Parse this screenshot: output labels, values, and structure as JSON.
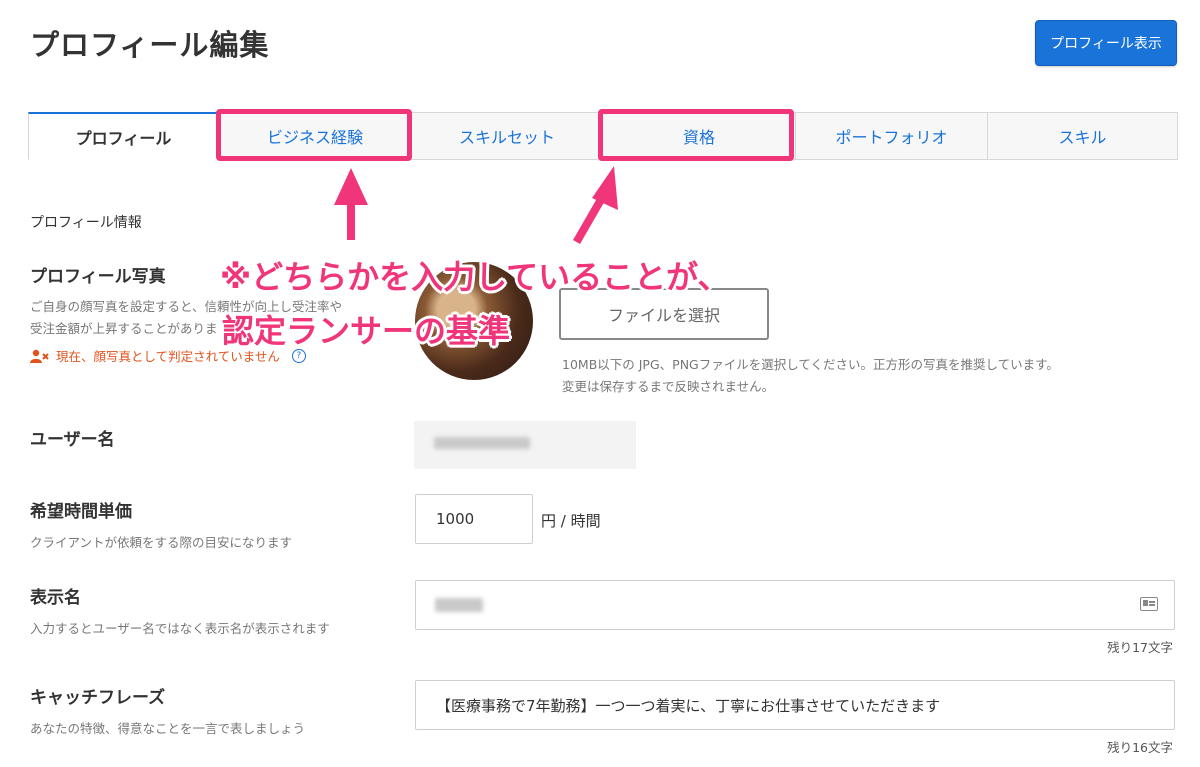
{
  "header": {
    "title": "プロフィール編集",
    "view_button": "プロフィール表示"
  },
  "tabs": [
    {
      "label": "プロフィール"
    },
    {
      "label": "ビジネス経験"
    },
    {
      "label": "スキルセット"
    },
    {
      "label": "資格"
    },
    {
      "label": "ポートフォリオ"
    },
    {
      "label": "スキル"
    }
  ],
  "section_label": "プロフィール情報",
  "photo": {
    "title": "プロフィール写真",
    "desc_line1": "ご自身の顔写真を設定すると、信頼性が向上し受注率や",
    "desc_line2": "受注金額が上昇することがありま",
    "warning": "現在、顔写真として判定されていません",
    "help": "?",
    "file_button": "ファイルを選択",
    "note_line1": "10MB以下の JPG、PNGファイルを選択してください。正方形の写真を推奨しています。",
    "note_line2": "変更は保存するまで反映されません。"
  },
  "username": {
    "title": "ユーザー名"
  },
  "hourly": {
    "title": "希望時間単価",
    "desc": "クライアントが依頼をする際の目安になります",
    "value": "1000",
    "unit": "円 / 時間"
  },
  "display_name": {
    "title": "表示名",
    "desc": "入力するとユーザー名ではなく表示名が表示されます",
    "counter": "残り17文字"
  },
  "catchphrase": {
    "title": "キャッチフレーズ",
    "desc": "あなたの特徴、得意なことを一言で表しましょう",
    "value": "【医療事務で7年勤務】一つ一つ着実に、丁寧にお仕事させていただきます",
    "counter": "残り16文字"
  },
  "annotation": {
    "line1": "※どちらかを入力していることが、",
    "line2": "認定ランサーの基準",
    "color": "#f0357a"
  }
}
